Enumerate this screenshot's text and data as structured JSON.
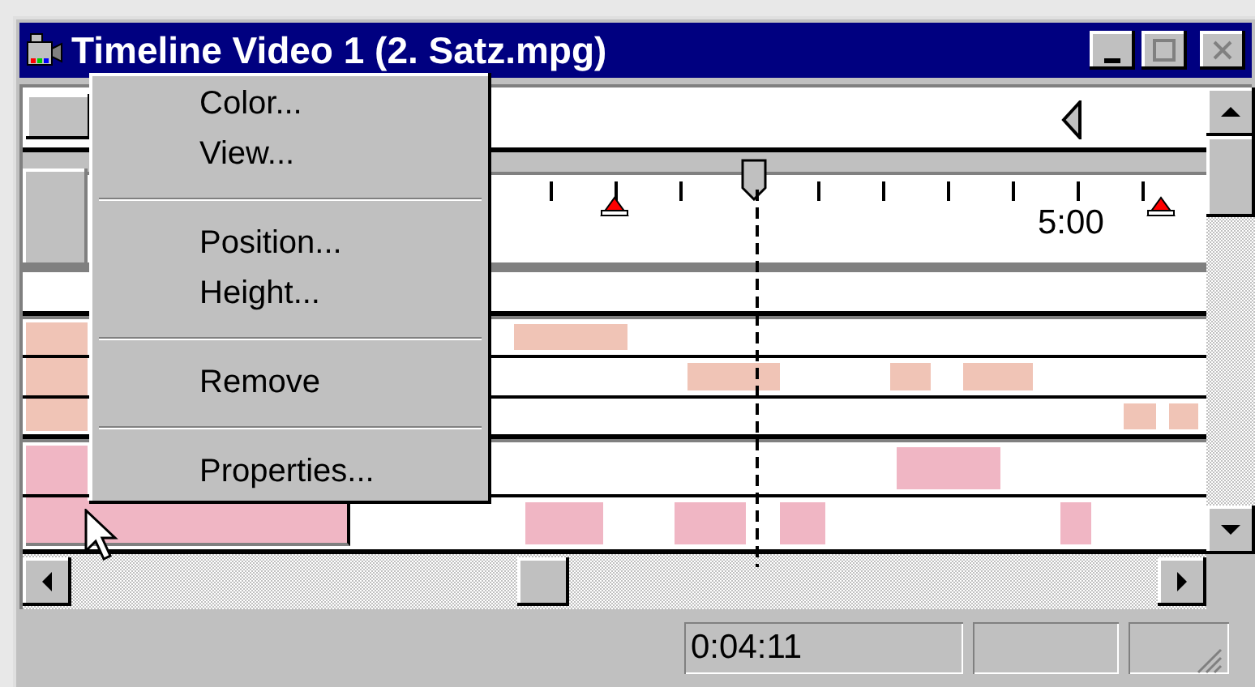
{
  "window": {
    "title": "Timeline Video 1 (2. Satz.mpg)"
  },
  "ruler": {
    "label": "5:00"
  },
  "track_groups": [
    {
      "kind": "empty"
    },
    {
      "kind": "clips",
      "color": "#f0c4b6"
    },
    {
      "kind": "clips",
      "color": "#f0b6c4"
    }
  ],
  "context_menu": {
    "items": [
      {
        "kind": "item",
        "label": "Color..."
      },
      {
        "kind": "item",
        "label": "View..."
      },
      {
        "kind": "separator"
      },
      {
        "kind": "item",
        "label": "Position..."
      },
      {
        "kind": "item",
        "label": "Height..."
      },
      {
        "kind": "separator"
      },
      {
        "kind": "item",
        "label": "Remove"
      },
      {
        "kind": "separator"
      },
      {
        "kind": "item",
        "label": "Properties..."
      }
    ]
  },
  "status_bar": {
    "time": "0:04:11"
  }
}
